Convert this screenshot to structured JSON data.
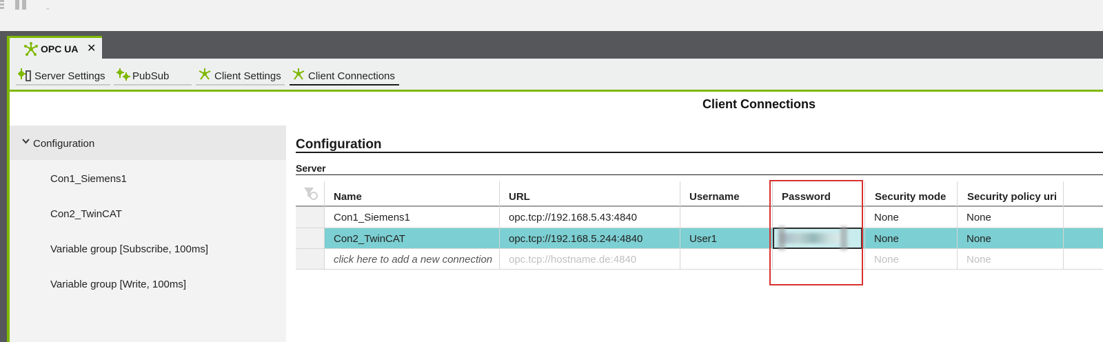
{
  "document_tab": {
    "label": "OPC UA",
    "close": "✕"
  },
  "sub_tabs": [
    {
      "label": "Server Settings"
    },
    {
      "label": "PubSub"
    },
    {
      "label": "Client Settings"
    },
    {
      "label": "Client Connections"
    }
  ],
  "page_title": "Client Connections",
  "tree": {
    "header": "Configuration",
    "items": [
      {
        "label": "Con1_Siemens1"
      },
      {
        "label": "Con2_TwinCAT"
      },
      {
        "label": "Variable group [Subscribe, 100ms]"
      },
      {
        "label": "Variable group [Write, 100ms]"
      }
    ]
  },
  "section": {
    "heading": "Configuration",
    "subheading": "Server"
  },
  "table": {
    "columns": [
      "Name",
      "URL",
      "Username",
      "Password",
      "Security mode",
      "Security policy uri"
    ],
    "rows": [
      {
        "name": "Con1_Siemens1",
        "url": "opc.tcp://192.168.5.43:4840",
        "username": "",
        "password": "",
        "security_mode": "None",
        "security_policy": "None"
      },
      {
        "name": "Con2_TwinCAT",
        "url": "opc.tcp://192.168.5.244:4840",
        "username": "User1",
        "password": "",
        "security_mode": "None",
        "security_policy": "None"
      }
    ],
    "new_row": {
      "name": "click here to add a new connection",
      "url": "opc.tcp://hostname.de:4840",
      "security_mode": "None",
      "security_policy": "None"
    }
  },
  "colors": {
    "accent": "#7fb800",
    "selected_row": "#7ccfd2",
    "highlight_box": "#d93030",
    "dark_band": "#56575a"
  }
}
